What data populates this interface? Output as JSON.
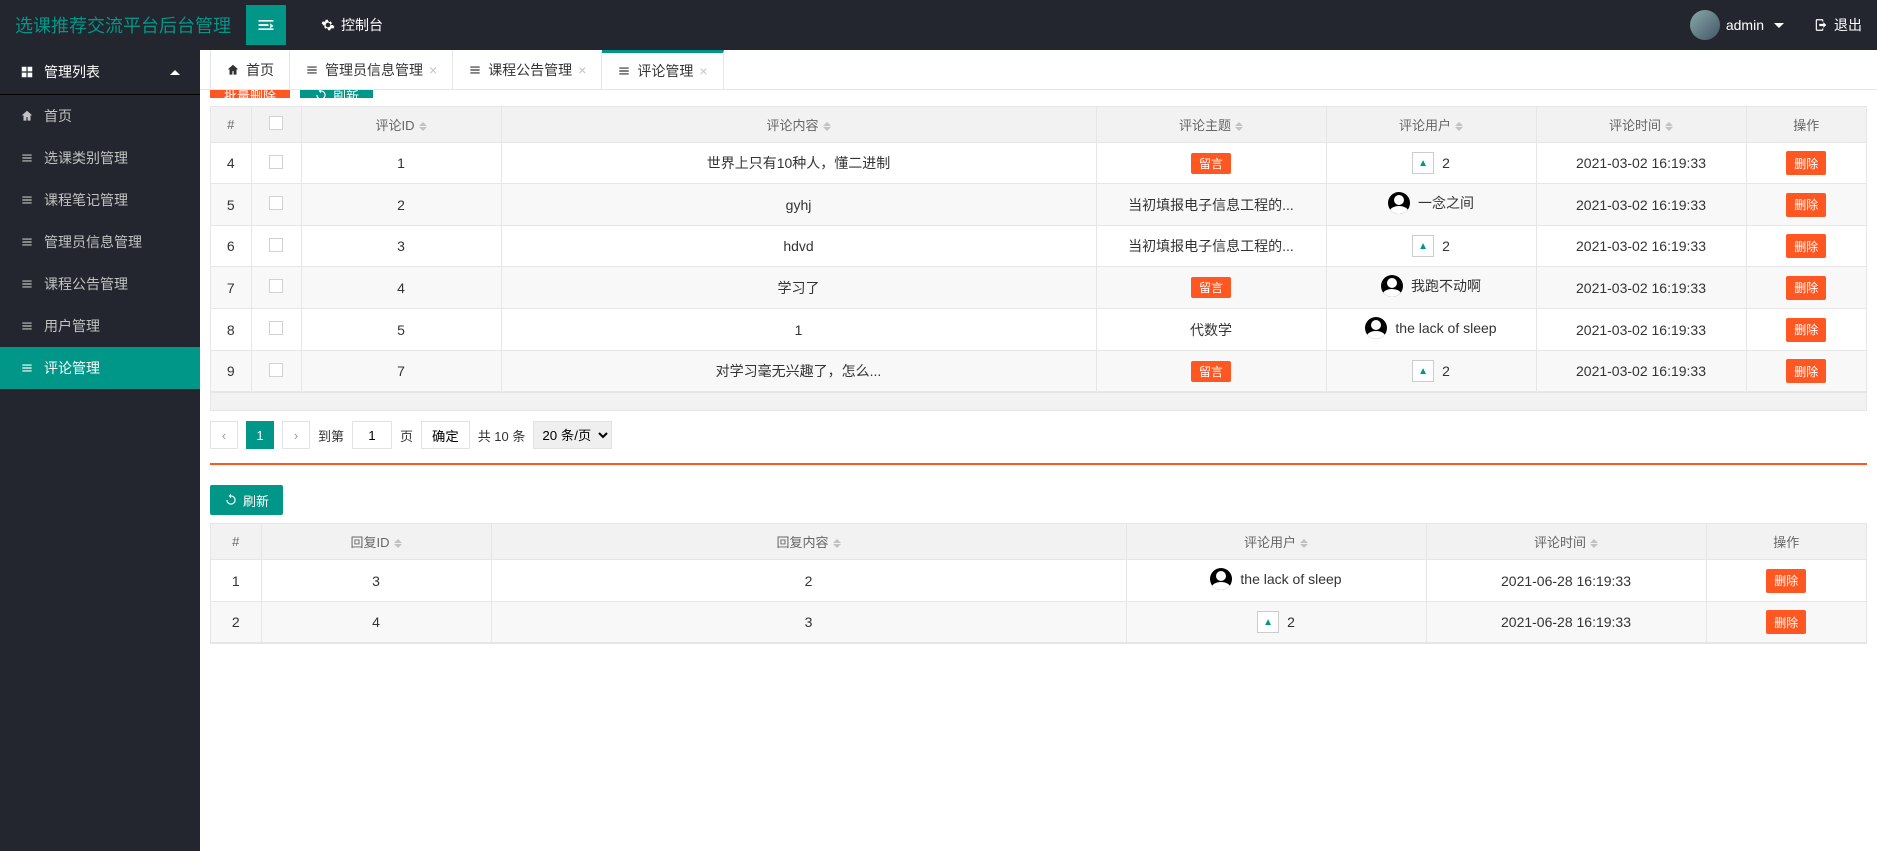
{
  "header": {
    "brand": "选课推荐交流平台后台管理",
    "console": "控制台",
    "user": "admin",
    "logout": "退出"
  },
  "sidebar": {
    "group": "管理列表",
    "items": [
      {
        "label": "首页"
      },
      {
        "label": "选课类别管理"
      },
      {
        "label": "课程笔记管理"
      },
      {
        "label": "管理员信息管理"
      },
      {
        "label": "课程公告管理"
      },
      {
        "label": "用户管理"
      },
      {
        "label": "评论管理"
      }
    ]
  },
  "tabs": [
    {
      "label": "首页",
      "closable": false
    },
    {
      "label": "管理员信息管理",
      "closable": true
    },
    {
      "label": "课程公告管理",
      "closable": true
    },
    {
      "label": "评论管理",
      "closable": true,
      "active": true
    }
  ],
  "toolbar": {
    "batch_delete": "批量删除",
    "refresh": "刷新"
  },
  "table1": {
    "headers": [
      "#",
      "",
      "评论ID",
      "评论内容",
      "评论主题",
      "评论用户",
      "评论时间",
      "操作"
    ],
    "badge_label": "留言",
    "delete_label": "删除",
    "rows": [
      {
        "n": "4",
        "id": "1",
        "content": "世界上只有10种人，懂二进制",
        "topic_badge": true,
        "user_img": true,
        "user": "2",
        "time": "2021-03-02 16:19:33"
      },
      {
        "n": "5",
        "id": "2",
        "content": "gyhj",
        "topic_text": "当初填报电子信息工程的...",
        "user_ava": true,
        "user": "一念之间",
        "time": "2021-03-02 16:19:33"
      },
      {
        "n": "6",
        "id": "3",
        "content": "hdvd",
        "topic_text": "当初填报电子信息工程的...",
        "user_img": true,
        "user": "2",
        "time": "2021-03-02 16:19:33"
      },
      {
        "n": "7",
        "id": "4",
        "content": "学习了",
        "topic_badge": true,
        "user_ava": true,
        "user": "我跑不动啊",
        "time": "2021-03-02 16:19:33"
      },
      {
        "n": "8",
        "id": "5",
        "content": "1",
        "topic_text": "代数学",
        "user_ava": true,
        "user": "the lack of sleep",
        "time": "2021-03-02 16:19:33"
      },
      {
        "n": "9",
        "id": "7",
        "content": "对学习毫无兴趣了，怎么...",
        "topic_badge": true,
        "user_img": true,
        "user": "2",
        "time": "2021-03-02 16:19:33"
      }
    ]
  },
  "pager": {
    "goto_label": "到第",
    "page_label": "页",
    "confirm": "确定",
    "total": "共 10 条",
    "per_page": "20 条/页",
    "current": "1",
    "input": "1"
  },
  "table2": {
    "refresh": "刷新",
    "headers": [
      "#",
      "回复ID",
      "回复内容",
      "评论用户",
      "评论时间",
      "操作"
    ],
    "delete_label": "删除",
    "rows": [
      {
        "n": "1",
        "id": "3",
        "content": "2",
        "user_ava": true,
        "user": "the lack of sleep",
        "time": "2021-06-28 16:19:33"
      },
      {
        "n": "2",
        "id": "4",
        "content": "3",
        "user_img": true,
        "user": "2",
        "time": "2021-06-28 16:19:33"
      }
    ]
  }
}
